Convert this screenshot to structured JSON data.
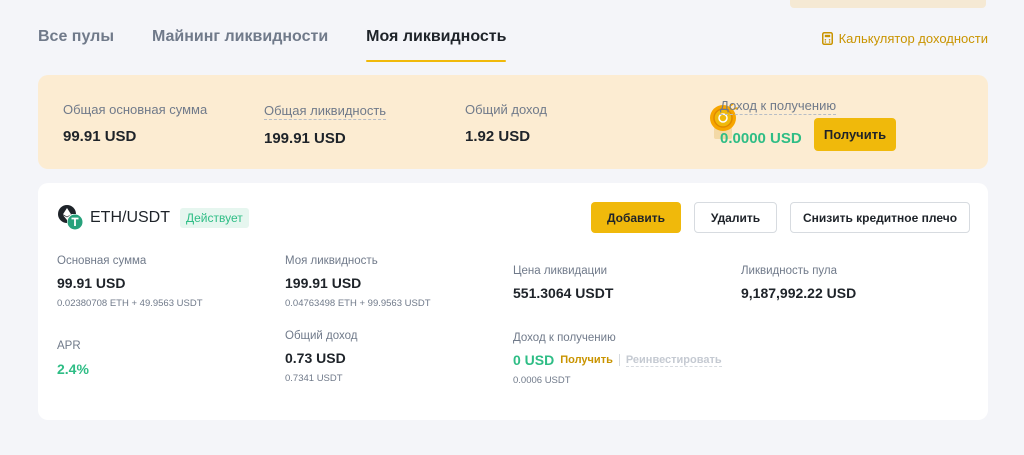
{
  "tabs": [
    {
      "label": "Все пулы"
    },
    {
      "label": "Майнинг ликвидности"
    },
    {
      "label": "Моя ликвидность"
    }
  ],
  "calculator_link": "Калькулятор доходности",
  "summary": {
    "principal_label": "Общая основная сумма",
    "principal_value": "99.91 USD",
    "liquidity_label": "Общая ликвидность",
    "liquidity_value": "199.91 USD",
    "income_label": "Общий доход",
    "income_value": "1.92 USD",
    "claimable_label": "Доход к получению",
    "claimable_value": "0.0000 USD",
    "claim_button": "Получить"
  },
  "pool": {
    "pair": "ETH/USDT",
    "status": "Действует",
    "buttons": {
      "add": "Добавить",
      "remove": "Удалить",
      "reduce_leverage": "Снизить кредитное плечо"
    },
    "principal": {
      "label": "Основная сумма",
      "value": "99.91 USD",
      "sub": "0.02380708 ETH + 49.9563 USDT"
    },
    "my_liquidity": {
      "label": "Моя ликвидность",
      "value": "199.91 USD",
      "sub": "0.04763498 ETH + 99.9563 USDT"
    },
    "liquidation_price": {
      "label": "Цена ликвидации",
      "value": "551.3064 USDT"
    },
    "pool_liquidity": {
      "label": "Ликвидность пула",
      "value": "9,187,992.22 USD"
    },
    "apr": {
      "label": "APR",
      "value": "2.4%"
    },
    "total_income": {
      "label": "Общий доход",
      "value": "0.73 USD",
      "sub": "0.7341 USDT"
    },
    "claimable": {
      "label": "Доход к получению",
      "value": "0 USD",
      "claim": "Получить",
      "reinvest": "Реинвестировать",
      "sub": "0.0006 USDT"
    }
  },
  "colors": {
    "accent": "#f0b90b",
    "link": "#c99400",
    "green": "#2ebd85",
    "summary_bg": "#fcecd2"
  },
  "icons": [
    "calculator-icon",
    "coin-icon",
    "eth-icon",
    "usdt-icon"
  ]
}
